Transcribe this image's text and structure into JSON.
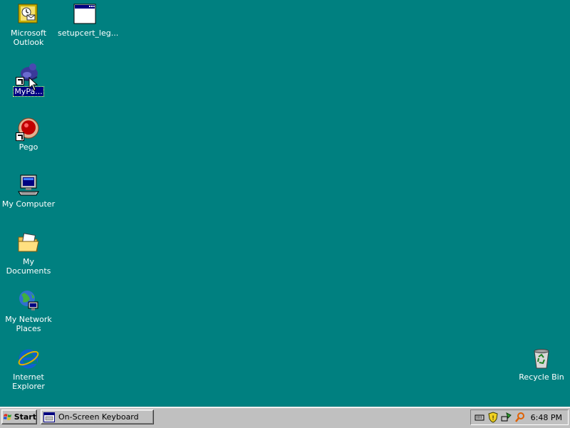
{
  "desktop": {
    "icons": [
      {
        "label": "Microsoft\nOutlook"
      },
      {
        "label": "setupcert_leg..."
      },
      {
        "label": "MyPa..."
      },
      {
        "label": "Pego"
      },
      {
        "label": "My Computer"
      },
      {
        "label": "My Documents"
      },
      {
        "label": "My Network\nPlaces"
      },
      {
        "label": "Internet\nExplorer"
      },
      {
        "label": "Recycle Bin"
      }
    ],
    "background_color": "#008080",
    "selection_color": "#000080"
  },
  "taskbar": {
    "start_label": "Start",
    "task_label": "On-Screen Keyboard",
    "clock": "6:48 PM",
    "tray_icons": [
      "keyboard-tray-icon",
      "security-shield-icon",
      "network-tray-icon",
      "search-tray-icon"
    ]
  }
}
